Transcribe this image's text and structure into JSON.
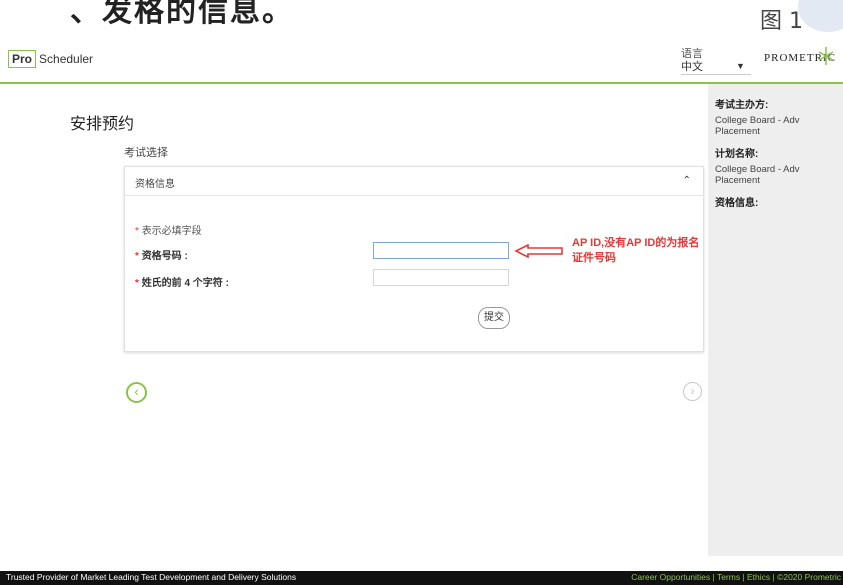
{
  "caption": {
    "left_text": "、发格的信息。",
    "right_text": "图 1"
  },
  "header": {
    "logo_pro": "Pro",
    "logo_scheduler": "Scheduler",
    "language_label": "语言",
    "language_value": "中文",
    "brand": "PROMETRIC"
  },
  "sidebar": {
    "sponsor_label": "考试主办方:",
    "sponsor_value": "College Board - Adv Placement",
    "program_label": "计划名称:",
    "program_value": "College Board - Adv Placement",
    "eligibility_label": "资格信息:"
  },
  "main": {
    "page_title": "安排预约",
    "section_label": "考试选择",
    "panel_title": "资格信息",
    "required_note": "表示必填字段",
    "field1_label": "资格号码 :",
    "field1_value": "",
    "field2_label": "姓氏的前 4 个字符 :",
    "field2_value": "",
    "submit_label": "提交"
  },
  "annotation": {
    "text": "AP ID,没有AP ID的为报名证件号码"
  },
  "footer": {
    "left": "Trusted Provider of Market Leading Test Development and Delivery Solutions",
    "right": "Career Opportunities | Terms | Ethics | ©2020 Prometric"
  },
  "colors": {
    "accent_green": "#8bc34a",
    "required_red": "#e53935",
    "footer_bg": "#111111",
    "sidebar_bg": "#eeeeee"
  },
  "icons": {
    "collapse": "chevron-up-icon",
    "language_dropdown": "chevron-down-icon",
    "prev": "circle-chevron-left-icon",
    "next": "circle-chevron-right-icon",
    "annotation_arrow": "left-arrow-icon"
  }
}
